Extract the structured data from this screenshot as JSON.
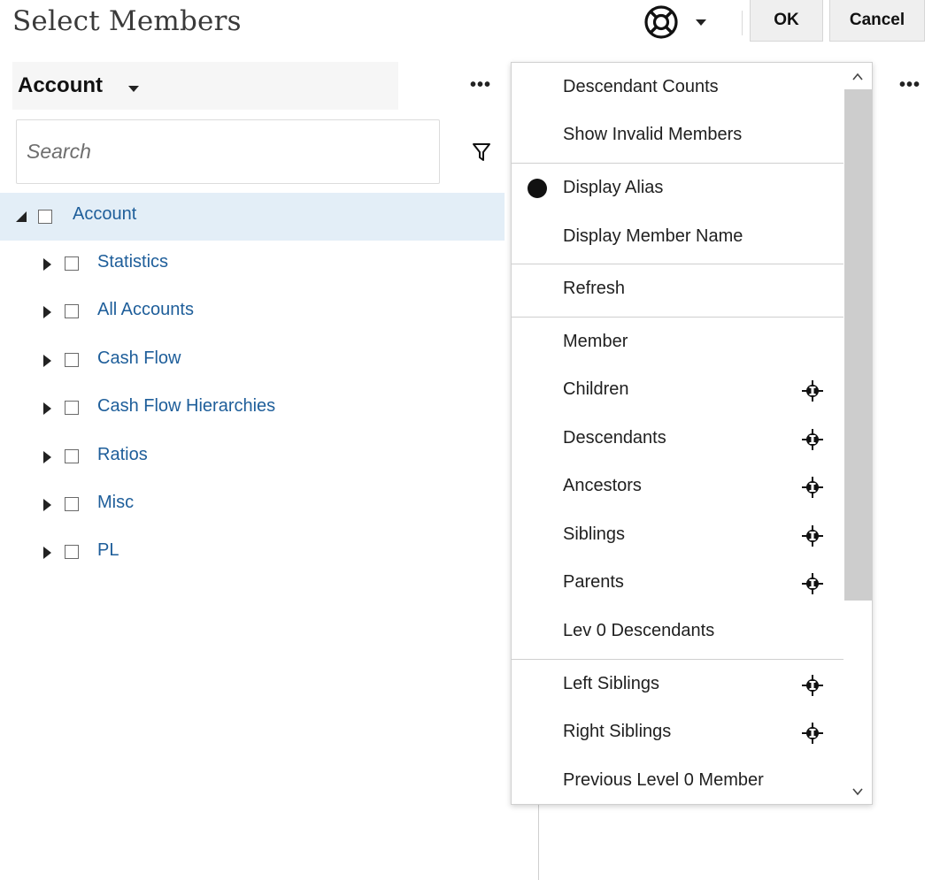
{
  "header": {
    "title": "Select Members",
    "help_icon": "lifebuoy-icon",
    "ok_label": "OK",
    "cancel_label": "Cancel"
  },
  "dimension": {
    "label": "Account",
    "more_icon": "ellipsis-icon"
  },
  "search": {
    "placeholder": "Search",
    "value": ""
  },
  "tree": {
    "root": {
      "label": "Account",
      "expanded": true,
      "checked": false
    },
    "children": [
      {
        "label": "Statistics"
      },
      {
        "label": "All Accounts"
      },
      {
        "label": "Cash Flow"
      },
      {
        "label": "Cash Flow Hierarchies"
      },
      {
        "label": "Ratios"
      },
      {
        "label": "Misc"
      },
      {
        "label": "PL"
      }
    ]
  },
  "menu": {
    "items": [
      {
        "label": "Descendant Counts"
      },
      {
        "label": "Show Invalid Members"
      },
      {
        "label": "Display Alias",
        "selected": true
      },
      {
        "label": "Display Member Name"
      },
      {
        "label": "Refresh"
      },
      {
        "label": "Member"
      },
      {
        "label": "Children",
        "icon": "function-selector-icon"
      },
      {
        "label": "Descendants",
        "icon": "function-selector-icon"
      },
      {
        "label": "Ancestors",
        "icon": "function-selector-icon"
      },
      {
        "label": "Siblings",
        "icon": "function-selector-icon"
      },
      {
        "label": "Parents",
        "icon": "function-selector-icon"
      },
      {
        "label": "Lev 0 Descendants"
      },
      {
        "label": "Left Siblings",
        "icon": "function-selector-icon"
      },
      {
        "label": "Right Siblings",
        "icon": "function-selector-icon"
      },
      {
        "label": "Previous Level 0 Member"
      }
    ]
  },
  "colors": {
    "link": "#1e5e9a",
    "selected_row": "#e3eef7",
    "button_bg": "#efefef",
    "scroll_thumb": "#cdcdcd"
  }
}
